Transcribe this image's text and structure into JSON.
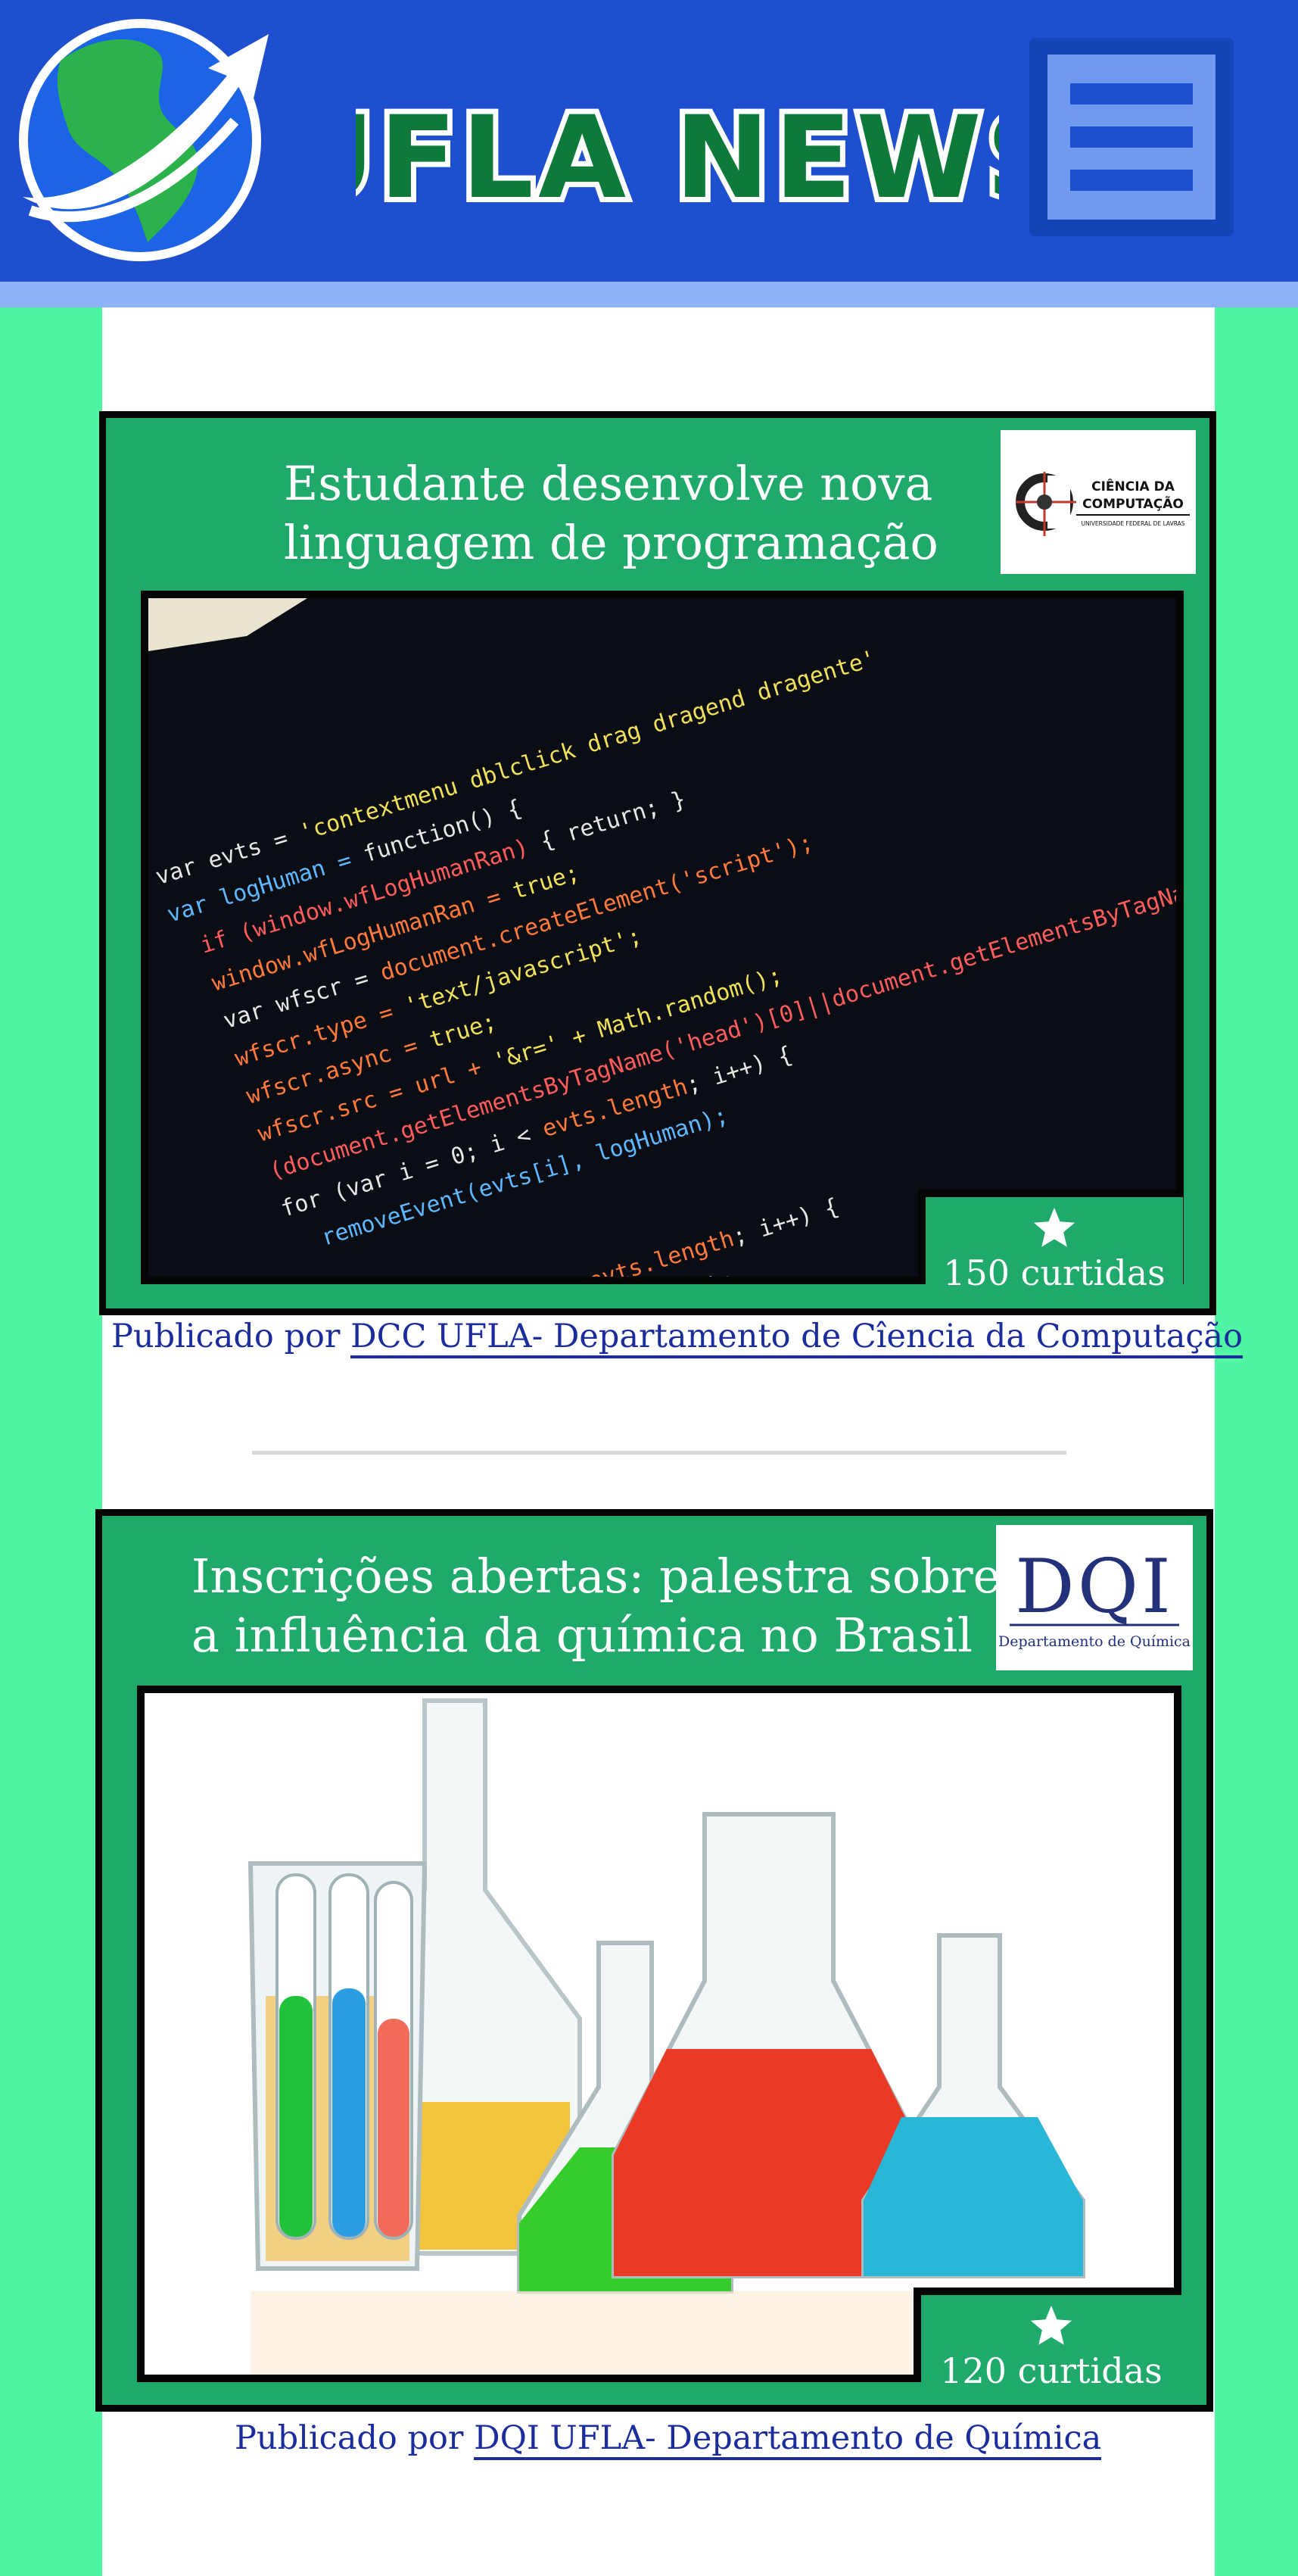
{
  "header": {
    "brand": "UFLA NEWS",
    "logo_icon": "globe-arrow-icon",
    "menu_icon": "hamburger-menu-icon",
    "colors": {
      "background": "#1d4fcf",
      "stripe": "#8db2f5",
      "brand_text": "#0d7a3a"
    }
  },
  "posts": [
    {
      "title_line1": "Estudante desenvolve nova",
      "title_line2": "linguagem de programação",
      "badge": {
        "line1": "CIÊNCIA DA",
        "line2": "COMPUTAÇÃO",
        "line3": "UNIVERSIDADE FEDERAL DE LAVRAS"
      },
      "image": "code-screenshot-image",
      "likes": "150 curtidas",
      "byline_prefix": "Publicado por",
      "author": "DCC UFLA- Departamento de Cîencia da Computação"
    },
    {
      "title_line1": "Inscrições abertas: palestra sobre",
      "title_line2": "a influência da química no Brasil",
      "badge": {
        "line1": "DQI",
        "line2": "Departamento de Química"
      },
      "image": "lab-glassware-image",
      "likes": "120 curtidas",
      "byline_prefix": "Publicado por",
      "author": "DQI UFLA- Departamento de Química"
    }
  ],
  "colors": {
    "page": "#4ff5a3",
    "card": "#1faa6b",
    "byline": "#1b2d9c"
  }
}
